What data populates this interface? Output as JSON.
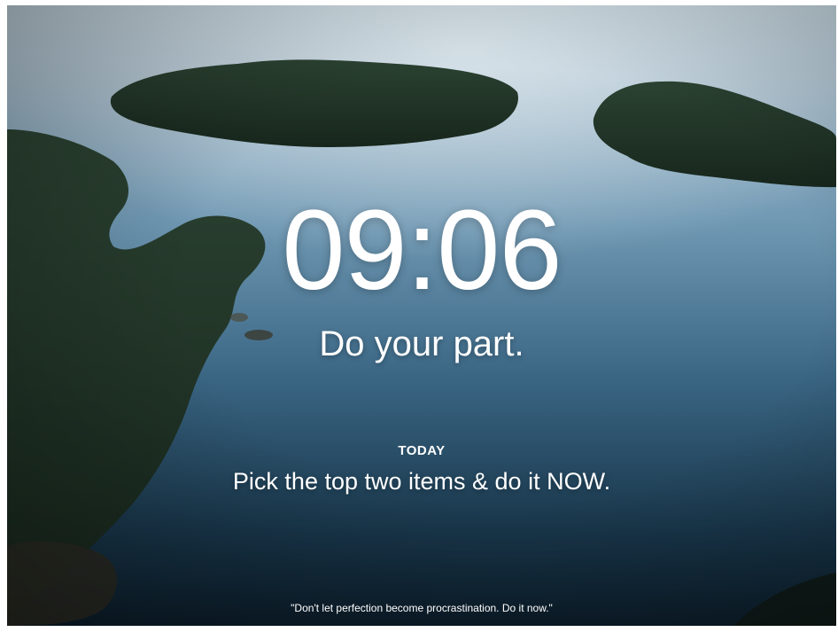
{
  "clock": {
    "time": "09:06"
  },
  "greeting": {
    "text": "Do your part."
  },
  "focus": {
    "label": "TODAY",
    "text": "Pick the top two items & do it NOW."
  },
  "quote": {
    "text": "\"Don't let perfection become procrastination. Do it now.\""
  },
  "colors": {
    "water_light": "#a9bfcb",
    "water_mid": "#4f7d9b",
    "water_dark": "#0f2434",
    "forest": "#1c2e22",
    "text": "#ffffff"
  }
}
